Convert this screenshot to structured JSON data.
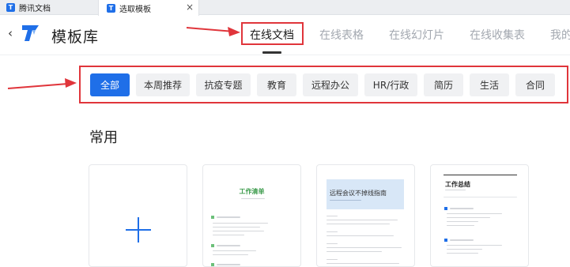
{
  "browser_tabs": [
    {
      "label": "腾讯文档"
    },
    {
      "label": "选取模板",
      "close": "×"
    }
  ],
  "header": {
    "back_icon": "chevron-left",
    "app_title": "模板库",
    "nav": [
      "在线文档",
      "在线表格",
      "在线幻灯片",
      "在线收集表",
      "我的"
    ],
    "active_nav": "在线文档"
  },
  "categories": [
    "全部",
    "本周推荐",
    "抗疫专题",
    "教育",
    "远程办公",
    "HR/行政",
    "简历",
    "生活",
    "合同"
  ],
  "active_category": "全部",
  "section": {
    "title": "常用"
  },
  "cards": [
    {
      "type": "new",
      "icon": "plus-icon"
    },
    {
      "type": "template",
      "title": "工作清单"
    },
    {
      "type": "template",
      "title": "远程会议不掉线指南"
    },
    {
      "type": "template",
      "title": "工作总结"
    }
  ],
  "colors": {
    "accent": "#1f6fe8",
    "annotation_red": "#e0353b"
  }
}
